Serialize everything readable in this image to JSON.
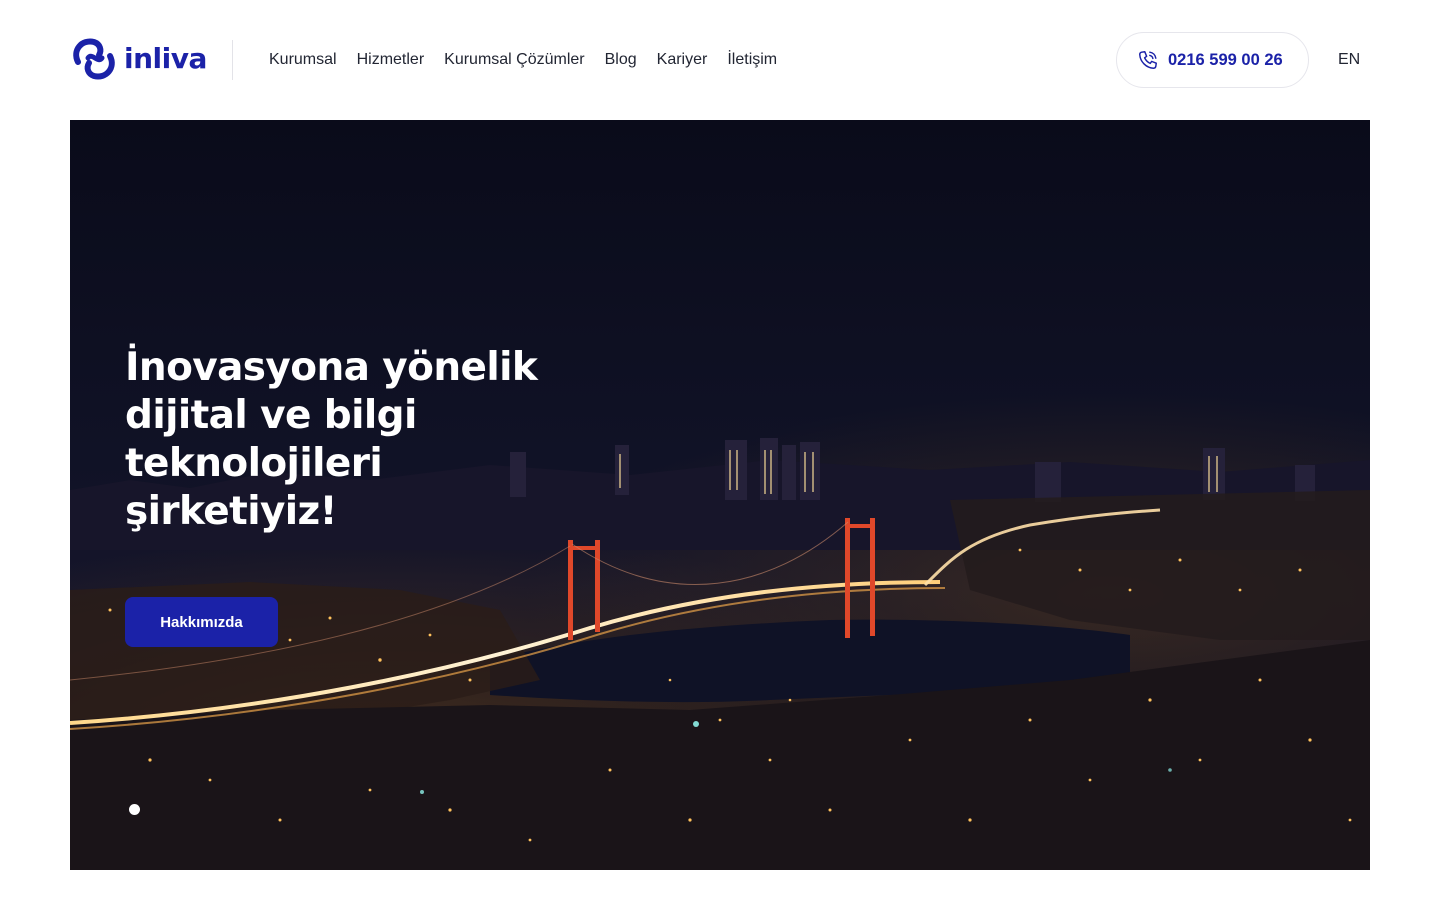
{
  "header": {
    "logo_text": "inliva",
    "nav": [
      {
        "label": "Kurumsal"
      },
      {
        "label": "Hizmetler"
      },
      {
        "label": "Kurumsal Çözümler"
      },
      {
        "label": "Blog"
      },
      {
        "label": "Kariyer"
      },
      {
        "label": "İletişim"
      }
    ],
    "phone": "0216 599 00 26",
    "phone_icon": "phone-icon",
    "language": "EN"
  },
  "hero": {
    "title": "İnovasyona yönelik\ndijital ve bilgi\nteknolojileri\nşirketiyiz!",
    "button_label": "Hakkımızda",
    "slide_count": 1,
    "active_slide": 1
  },
  "colors": {
    "brand": "#1b22a8",
    "text": "#222633",
    "hero_background": "#0b0c1e"
  }
}
